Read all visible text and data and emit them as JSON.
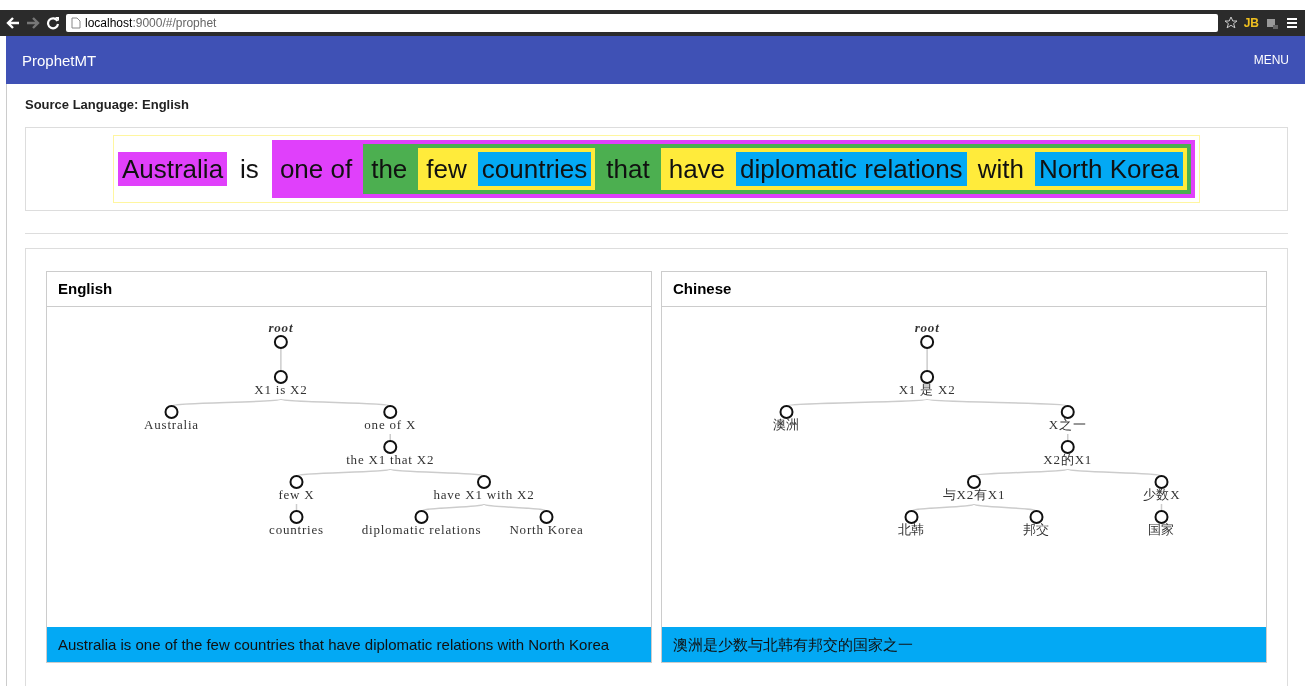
{
  "browser": {
    "url_host": "localhost",
    "url_rest": ":9000/#/prophet",
    "extension_label": "JB"
  },
  "app_bar": {
    "title": "ProphetMT",
    "menu": "MENU"
  },
  "source_language": "Source Language: English",
  "sentence": {
    "kind": "frame",
    "children": [
      {
        "kind": "word",
        "text": "Australia",
        "color": "#e040fb"
      },
      {
        "kind": "word",
        "text": "is",
        "color": "#ffffff"
      },
      {
        "kind": "group",
        "color": "#e040fb",
        "children": [
          {
            "kind": "word",
            "text": "one of",
            "color": "#e040fb"
          },
          {
            "kind": "group",
            "color": "#4caf50",
            "children": [
              {
                "kind": "word",
                "text": "the",
                "color": "#4caf50"
              },
              {
                "kind": "group",
                "color": "#ffeb3b",
                "children": [
                  {
                    "kind": "word",
                    "text": "few",
                    "color": "#ffeb3b"
                  },
                  {
                    "kind": "word",
                    "text": "countries",
                    "color": "#03a9f4"
                  }
                ]
              },
              {
                "kind": "word",
                "text": "that",
                "color": "#4caf50"
              },
              {
                "kind": "group",
                "color": "#ffeb3b",
                "children": [
                  {
                    "kind": "word",
                    "text": "have",
                    "color": "#ffeb3b"
                  },
                  {
                    "kind": "word",
                    "text": "diplomatic relations",
                    "color": "#03a9f4"
                  },
                  {
                    "kind": "word",
                    "text": "with",
                    "color": "#ffeb3b"
                  },
                  {
                    "kind": "word",
                    "text": "North Korea",
                    "color": "#03a9f4"
                  }
                ]
              }
            ]
          }
        ]
      }
    ]
  },
  "panels": [
    {
      "title": "English",
      "tree": {
        "label": "root",
        "children": [
          {
            "label": "X1 is X2",
            "children": [
              {
                "label": "Australia"
              },
              {
                "label": "one of X",
                "children": [
                  {
                    "label": "the X1 that X2",
                    "children": [
                      {
                        "label": "few X",
                        "children": [
                          {
                            "label": "countries"
                          }
                        ]
                      },
                      {
                        "label": "have X1 with X2",
                        "children": [
                          {
                            "label": "diplomatic relations"
                          },
                          {
                            "label": "North Korea"
                          }
                        ]
                      }
                    ]
                  }
                ]
              }
            ]
          }
        ]
      },
      "translation": "Australia is one of the few countries that have diplomatic relations with North Korea"
    },
    {
      "title": "Chinese",
      "tree": {
        "label": "root",
        "children": [
          {
            "label": "X1 是 X2",
            "children": [
              {
                "label": "澳洲"
              },
              {
                "label": "X之一",
                "children": [
                  {
                    "label": "X2的X1",
                    "children": [
                      {
                        "label": "与X2有X1",
                        "children": [
                          {
                            "label": "北韩"
                          },
                          {
                            "label": "邦交"
                          }
                        ]
                      },
                      {
                        "label": "少数X",
                        "children": [
                          {
                            "label": "国家"
                          }
                        ]
                      }
                    ]
                  }
                ]
              }
            ]
          }
        ]
      },
      "translation": "澳洲是少数与北韩有邦交的国家之一"
    }
  ]
}
